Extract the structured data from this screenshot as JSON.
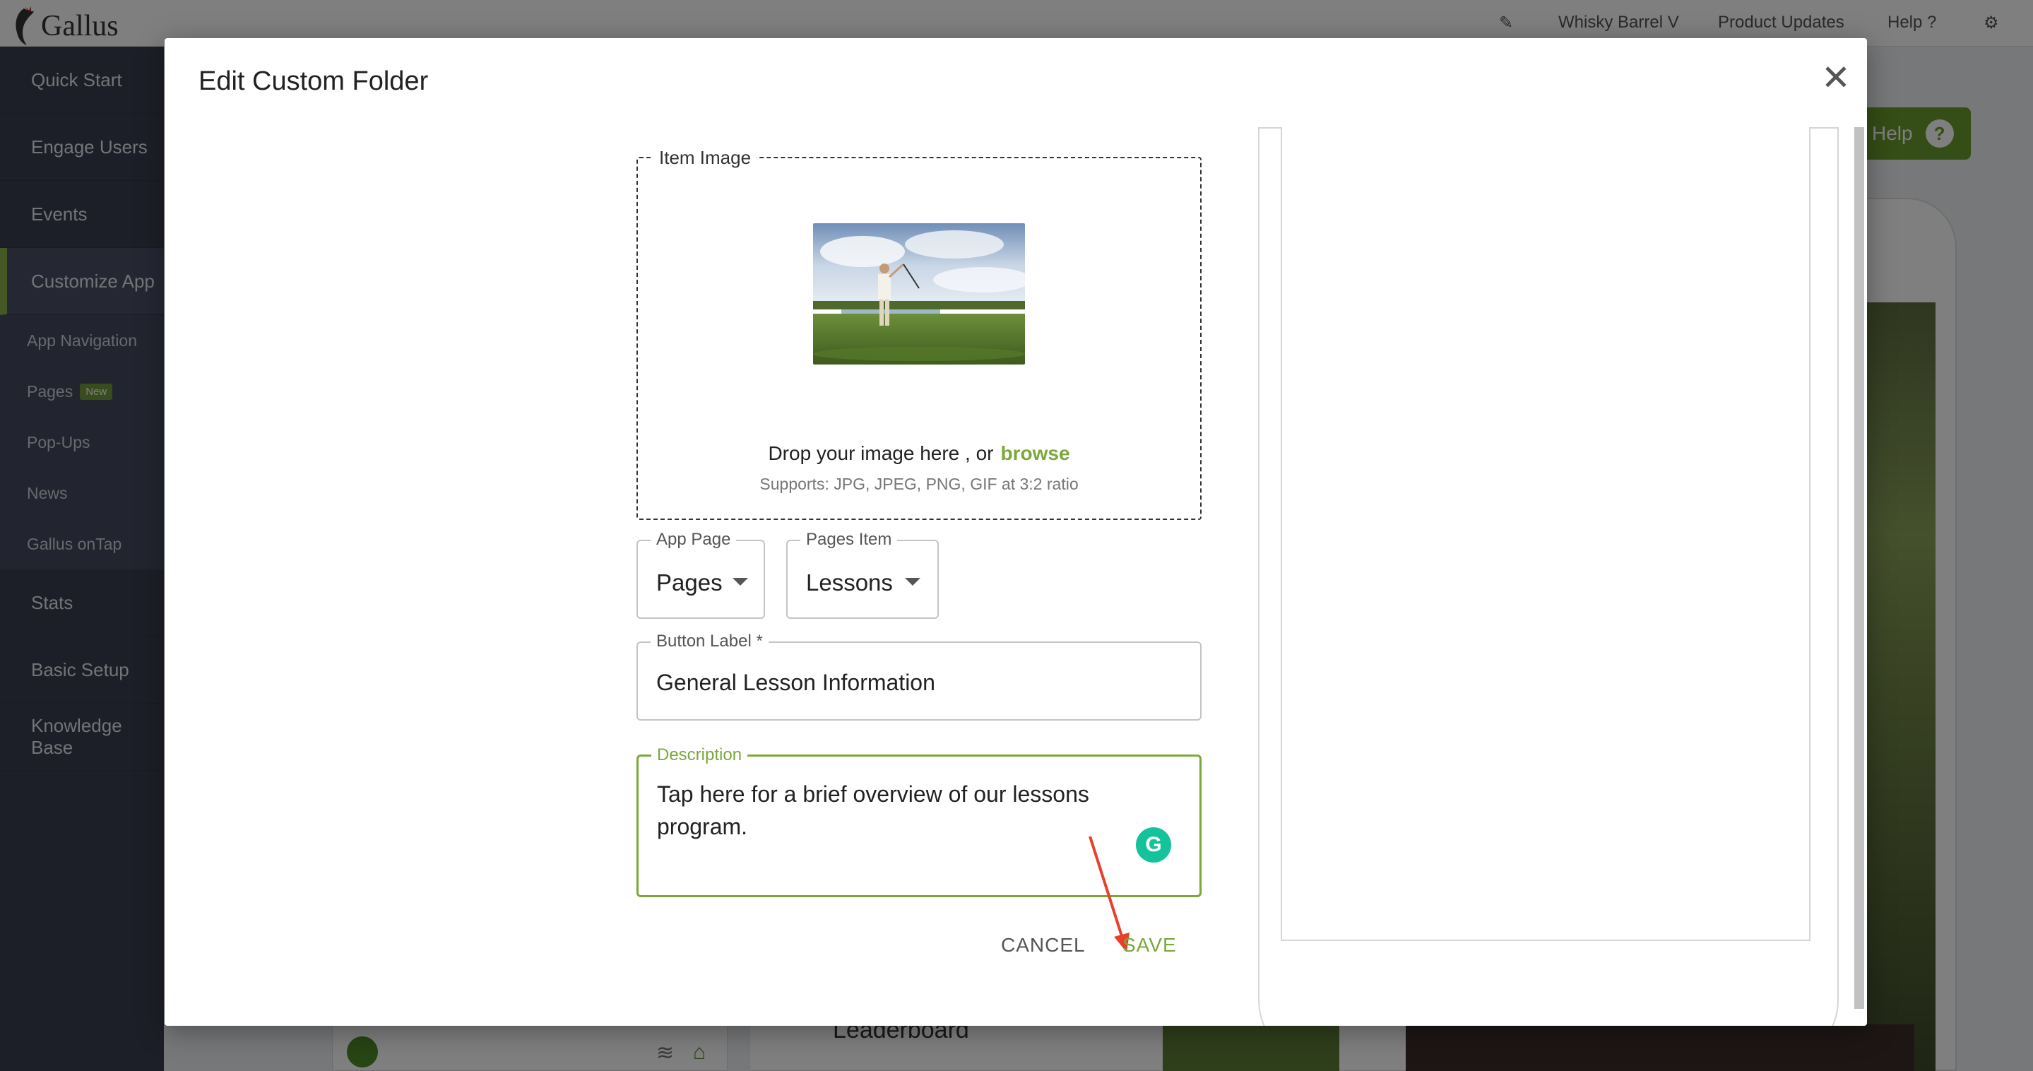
{
  "app": {
    "brand": "Gallus",
    "course_name": "Whisky Barrel V",
    "product_updates": "Product Updates",
    "help_label": "Help"
  },
  "sidebar": {
    "items": [
      {
        "label": "Quick Start"
      },
      {
        "label": "Engage Users"
      },
      {
        "label": "Events"
      },
      {
        "label": "Customize App"
      }
    ],
    "subitems": [
      {
        "label": "App Navigation"
      },
      {
        "label": "Pages",
        "badge": "New"
      },
      {
        "label": "Pop-Ups"
      },
      {
        "label": "News"
      },
      {
        "label": "Gallus onTap"
      }
    ],
    "bottom_items": [
      {
        "label": "Stats"
      },
      {
        "label": "Basic Setup"
      },
      {
        "label": "Knowledge Base"
      }
    ]
  },
  "background": {
    "help_button": "Help",
    "card_label": "Leaderboard"
  },
  "modal": {
    "title": "Edit Custom Folder",
    "close_icon": "close-icon",
    "item_image": {
      "legend": "Item Image",
      "drop_text": "Drop your image here , or",
      "browse_text": "browse",
      "supports_text": "Supports: JPG, JPEG, PNG, GIF at 3:2 ratio"
    },
    "app_page": {
      "legend": "App Page",
      "value": "Pages"
    },
    "pages_item": {
      "legend": "Pages Item",
      "value": "Lessons"
    },
    "button_label": {
      "legend": "Button Label *",
      "value": "General Lesson Information"
    },
    "description": {
      "legend": "Description",
      "value": "Tap here for a brief overview of our lessons program."
    },
    "cancel_label": "CANCEL",
    "save_label": "SAVE"
  },
  "colors": {
    "accent": "#7aa83a",
    "sidebar": "#3a3f51",
    "annotation_arrow": "#e8402a",
    "grammarly": "#15c39a"
  }
}
